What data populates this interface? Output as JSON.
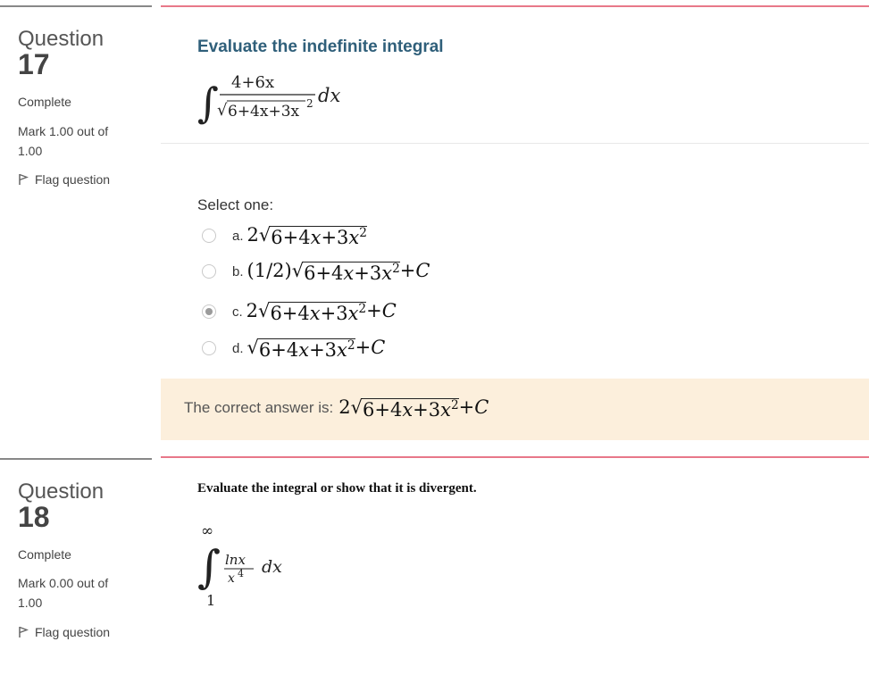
{
  "q17": {
    "label": "Question",
    "number": "17",
    "state": "Complete",
    "grade": "Mark 1.00 out of 1.00",
    "flag_label": "Flag question",
    "title": "Evaluate the indefinite integral",
    "integral": {
      "numerator": "4+6x",
      "denominator_radicand": "6+4x+3x",
      "denominator_power": "2",
      "differential": "dx"
    },
    "select_one": "Select one:",
    "options": [
      {
        "letter": "a.",
        "coef": "2",
        "radicand": "6+4x+3x",
        "power": "2",
        "suffix": "",
        "selected": false
      },
      {
        "letter": "b.",
        "coef": "(1/2)",
        "radicand": "6+4x+3x",
        "power": "2",
        "suffix": "+C",
        "selected": false
      },
      {
        "letter": "c.",
        "coef": "2",
        "radicand": "6+4x+3x",
        "power": "2",
        "suffix": "+C",
        "selected": true
      },
      {
        "letter": "d.",
        "coef": "",
        "radicand": "6+4x+3x",
        "power": "2",
        "suffix": "+C",
        "selected": false
      }
    ],
    "correct_label": "The correct answer is:",
    "correct": {
      "coef": "2",
      "radicand": "6+4x+3x",
      "power": "2",
      "suffix": "+C"
    }
  },
  "q18": {
    "label": "Question",
    "number": "18",
    "state": "Complete",
    "grade": "Mark 0.00 out of 1.00",
    "flag_label": "Flag question",
    "title": "Evaluate the integral or show that it is divergent.",
    "integral": {
      "upper": "∞",
      "lower": "1",
      "numerator": "lnx",
      "denominator_base": "x",
      "denominator_power": "4",
      "differential": "dx"
    }
  },
  "colors": {
    "accent_line": "#e87889",
    "title_blue": "#2f5f7a",
    "feedback_bg": "#fcefdc"
  }
}
